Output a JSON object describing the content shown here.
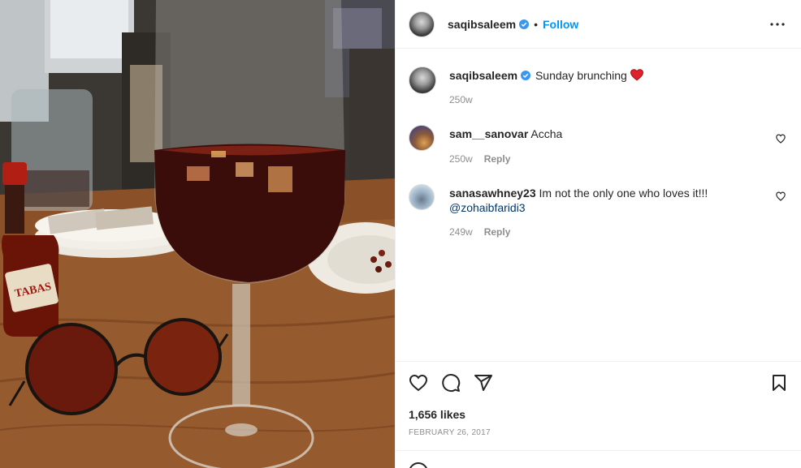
{
  "post": {
    "author": "saqibsaleem",
    "follow_label": "Follow",
    "separator": "•"
  },
  "caption": {
    "username": "saqibsaleem",
    "text": "Sunday brunching",
    "time": "250w"
  },
  "comments": [
    {
      "username": "sam__sanovar",
      "text": "Accha",
      "mention": "",
      "time": "250w",
      "reply_label": "Reply"
    },
    {
      "username": "sanasawhney23",
      "text": "Im not the only one who loves it!!!",
      "mention": "@zohaibfaridi3",
      "time": "249w",
      "reply_label": "Reply"
    }
  ],
  "footer": {
    "likes": "1,656 likes",
    "date": "FEBRUARY 26, 2017"
  },
  "photo": {
    "bottle_label": "TABAS"
  },
  "icons": {
    "like": "heart-icon",
    "comment": "comment-icon",
    "share": "paper-plane-icon",
    "save": "bookmark-icon",
    "more": "more-horizontal-icon",
    "verified": "verified-badge-icon"
  },
  "colors": {
    "link": "#0095f6",
    "verified": "#3897f0",
    "heart": "#ed4956",
    "muted": "#8e8e8e"
  }
}
